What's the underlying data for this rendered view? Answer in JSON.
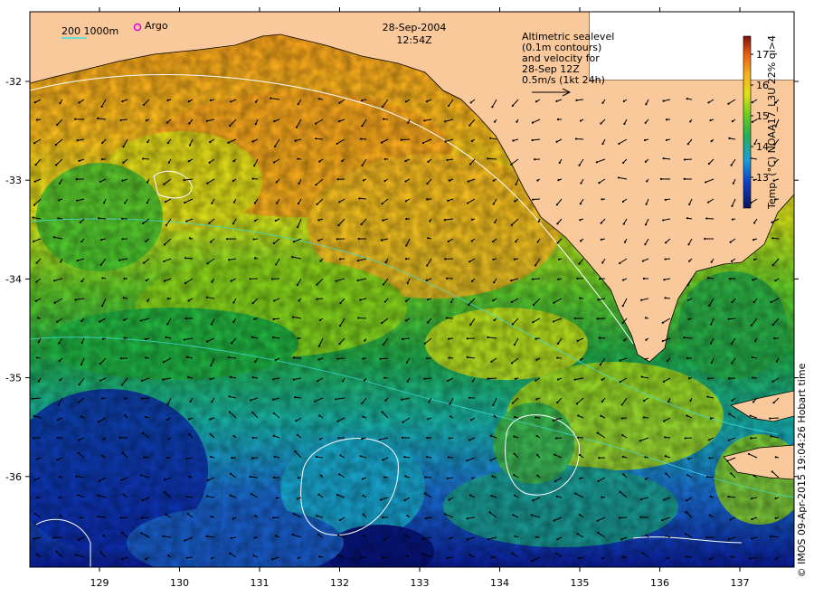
{
  "header": {
    "date": "28-Sep-2004",
    "time": "12:54Z"
  },
  "legend": {
    "depth_labels": "200  1000m",
    "argo_label": "Argo",
    "altimetry_lines": [
      "Altimetric sealevel",
      "(0.1m contours)",
      "and velocity for",
      "28-Sep 12Z",
      "0.5m/s (1kt 24h)"
    ]
  },
  "colorbar": {
    "title": "Temp. (°C) NOAA17_L3U 22% qi>4",
    "ticks": [
      "13",
      "14",
      "15",
      "16",
      "17"
    ]
  },
  "axes": {
    "x_ticks": [
      "129",
      "130",
      "131",
      "132",
      "133",
      "134",
      "135",
      "136",
      "137"
    ],
    "y_ticks": [
      "-32",
      "-33",
      "-34",
      "-35",
      "-36"
    ]
  },
  "credit": "© IMOS 09-Apr-2015 19:04:26 Hobart time",
  "colors": {
    "land": "#f9c89b",
    "ocean_warm": "#f7a820",
    "ocean_mid": "#d8e010",
    "ocean_cool": "#28b040",
    "ocean_cold": "#1070d0",
    "ocean_coldest": "#0a1ca0"
  }
}
